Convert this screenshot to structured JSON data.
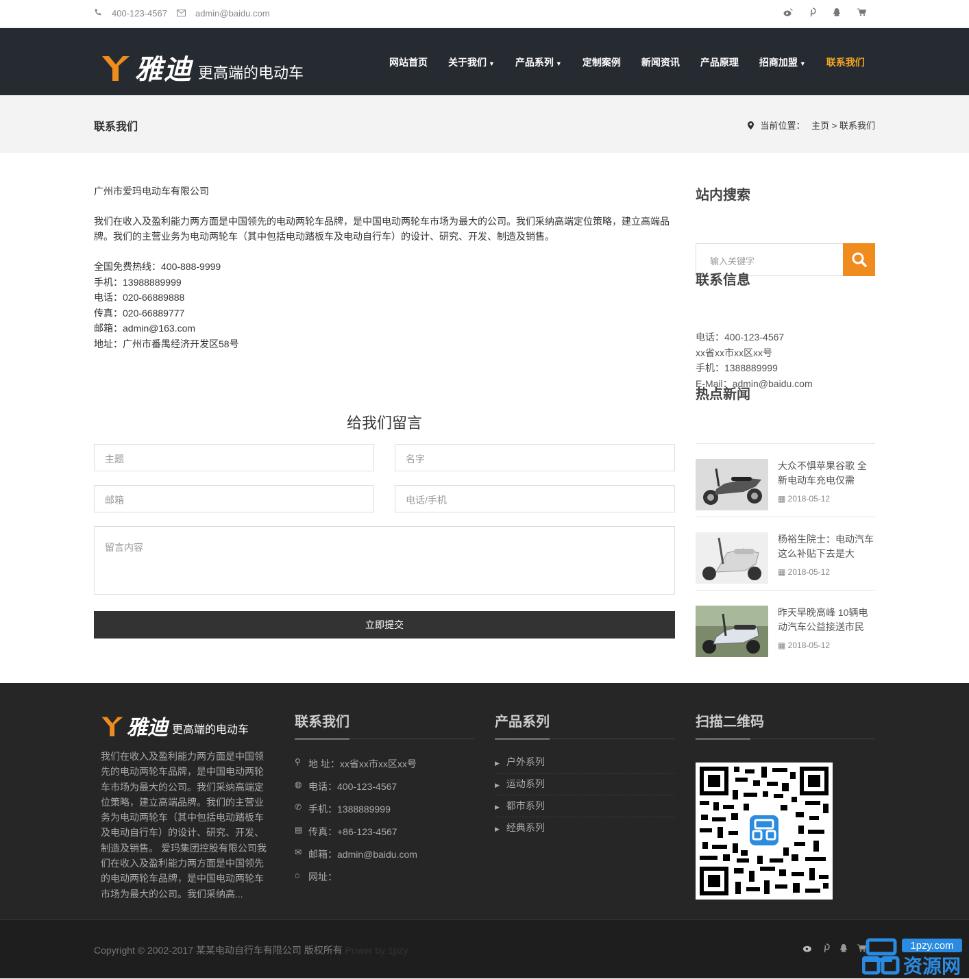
{
  "topbar": {
    "phone": "400-123-4567",
    "email": "admin@baidu.com",
    "icons": [
      "weibo-icon",
      "pinterest-icon",
      "qq-icon",
      "cart-icon"
    ]
  },
  "brand": {
    "name": "雅迪",
    "slogan": "更高端的电动车",
    "accent": "#f08c1e"
  },
  "nav": {
    "items": [
      {
        "label": "网站首页",
        "dropdown": false
      },
      {
        "label": "关于我们",
        "dropdown": true
      },
      {
        "label": "产品系列",
        "dropdown": true
      },
      {
        "label": "定制案例",
        "dropdown": false
      },
      {
        "label": "新闻资讯",
        "dropdown": false
      },
      {
        "label": "产品原理",
        "dropdown": false
      },
      {
        "label": "招商加盟",
        "dropdown": true
      },
      {
        "label": "联系我们",
        "dropdown": false,
        "active": true
      }
    ]
  },
  "crumb": {
    "title": "联系我们",
    "prefix": "当前位置：",
    "home": "主页",
    "sep": ">",
    "current": "联系我们"
  },
  "content": {
    "company": "广州市爱玛电动车有限公司",
    "intro": "我们在收入及盈利能力两方面是中国领先的电动两轮车品牌，是中国电动两轮车市场为最大的公司。我们采纳高端定位策略，建立高端品牌。我们的主营业务为电动两轮车（其中包括电动踏板车及电动自行车）的设计、研究、开发、制造及销售。",
    "lines": [
      "全国免费热线：400-888-9999",
      "手机：13988889999",
      "电话：020-66889888",
      "传真：020-66889777",
      "邮箱：admin@163.com",
      "地址：广州市番禺经济开发区58号"
    ]
  },
  "form": {
    "title": "给我们留言",
    "subject": "主题",
    "name": "名字",
    "email": "邮箱",
    "phone": "电话/手机",
    "message": "留言内容",
    "submit": "立即提交"
  },
  "sidebar": {
    "search_title": "站内搜索",
    "search_placeholder": "输入关键字",
    "contact_title": "联系信息",
    "contact_lines": [
      "电话：400-123-4567",
      "xx省xx市xx区xx号",
      "手机：1388889999",
      "E-Mail：admin@baidu.com"
    ],
    "hot_title": "热点新闻",
    "news": [
      {
        "title": "大众不惧苹果谷歌 全新电动车充电仅需",
        "date": "2018-05-12"
      },
      {
        "title": "杨裕生院士：电动汽车这么补贴下去是大",
        "date": "2018-05-12"
      },
      {
        "title": "昨天早晚高峰 10辆电动汽车公益接送市民",
        "date": "2018-05-12"
      }
    ]
  },
  "footer": {
    "desc": "我们在收入及盈利能力两方面是中国领先的电动两轮车品牌，是中国电动两轮车市场为最大的公司。我们采纳高端定位策略，建立高端品牌。我们的主营业务为电动两轮车（其中包括电动踏板车及电动自行车）的设计、研究、开发、制造及销售。 爱玛集团控股有限公司我们在收入及盈利能力两方面是中国领先的电动两轮车品牌，是中国电动两轮车市场为最大的公司。我们采纳高...",
    "contact_title": "联系我们",
    "contact": [
      {
        "icon": "map-marker-icon",
        "text": "地 址：xx省xx市xx区xx号"
      },
      {
        "icon": "globe-icon",
        "text": "电话：400-123-4567"
      },
      {
        "icon": "phone-icon",
        "text": "手机：1388889999"
      },
      {
        "icon": "fax-icon",
        "text": "传真：+86-123-4567"
      },
      {
        "icon": "envelope-icon",
        "text": "邮箱：admin@baidu.com"
      },
      {
        "icon": "home-icon",
        "text": "网址："
      }
    ],
    "products_title": "产品系列",
    "products": [
      "户外系列",
      "运动系列",
      "都市系列",
      "经典系列"
    ],
    "qr_title": "扫描二维码"
  },
  "bottom": {
    "copyright": "Copyright © 2002-2017 某某电动自行车有限公司 版权所有",
    "powered": "Power by 1pzy",
    "watermark_domain": "1pzy.com",
    "watermark_name": "资源网"
  }
}
